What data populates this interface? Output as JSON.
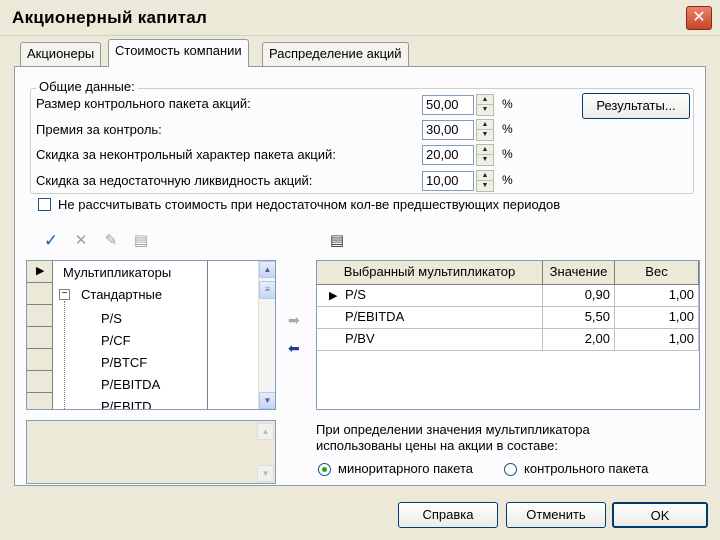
{
  "window": {
    "title": "Акционерный капитал",
    "close_glyph": "✕"
  },
  "tabs": [
    "Акционеры",
    "Стоимость компании",
    "Распределение акций"
  ],
  "general": {
    "legend": "Общие данные:",
    "rows": [
      {
        "label": "Размер контрольного пакета акций:",
        "value": "50,00",
        "unit": "%"
      },
      {
        "label": "Премия за контроль:",
        "value": "30,00",
        "unit": "%"
      },
      {
        "label": "Скидка за неконтрольный характер пакета акций:",
        "value": "20,00",
        "unit": "%"
      },
      {
        "label": "Скидка за недостаточную ликвидность акций:",
        "value": "10,00",
        "unit": "%"
      }
    ],
    "results_button": "Результаты...",
    "checkbox_label": "Не рассчитывать стоимость при недостаточном кол-ве предшествующих периодов",
    "checkbox_checked": false
  },
  "toolbar_icons": [
    "check-icon",
    "cross-icon",
    "edit-icon",
    "list-icon"
  ],
  "tree": {
    "items": [
      {
        "label": "Мультипликаторы",
        "level": 0,
        "selected": true
      },
      {
        "label": "Стандартные",
        "level": 1,
        "expander": "⊟"
      },
      {
        "label": "P/S",
        "level": 2
      },
      {
        "label": "P/CF",
        "level": 2
      },
      {
        "label": "P/BTCF",
        "level": 2
      },
      {
        "label": "P/EBITDA",
        "level": 2
      },
      {
        "label": "P/EBITD",
        "level": 2
      }
    ]
  },
  "mult_table": {
    "headers": [
      "Выбранный мультипликатор",
      "Значение",
      "Вес"
    ],
    "rows": [
      {
        "name": "P/S",
        "value": "0,90",
        "weight": "1,00",
        "current": true
      },
      {
        "name": "P/EBITDA",
        "value": "5,50",
        "weight": "1,00",
        "current": false
      },
      {
        "name": "P/BV",
        "value": "2,00",
        "weight": "1,00",
        "current": false
      }
    ]
  },
  "price_note": {
    "line1": "При определении значения мультипликатора",
    "line2": "использованы цены на акции в составе:",
    "options": [
      "миноритарного пакета",
      "контрольного пакета"
    ],
    "selected": 0
  },
  "buttons": {
    "help": "Справка",
    "cancel": "Отменить",
    "ok": "OK"
  },
  "glyphs": {
    "arrow_right": "➡",
    "arrow_left": "⬅",
    "row_pointer": "▶"
  }
}
